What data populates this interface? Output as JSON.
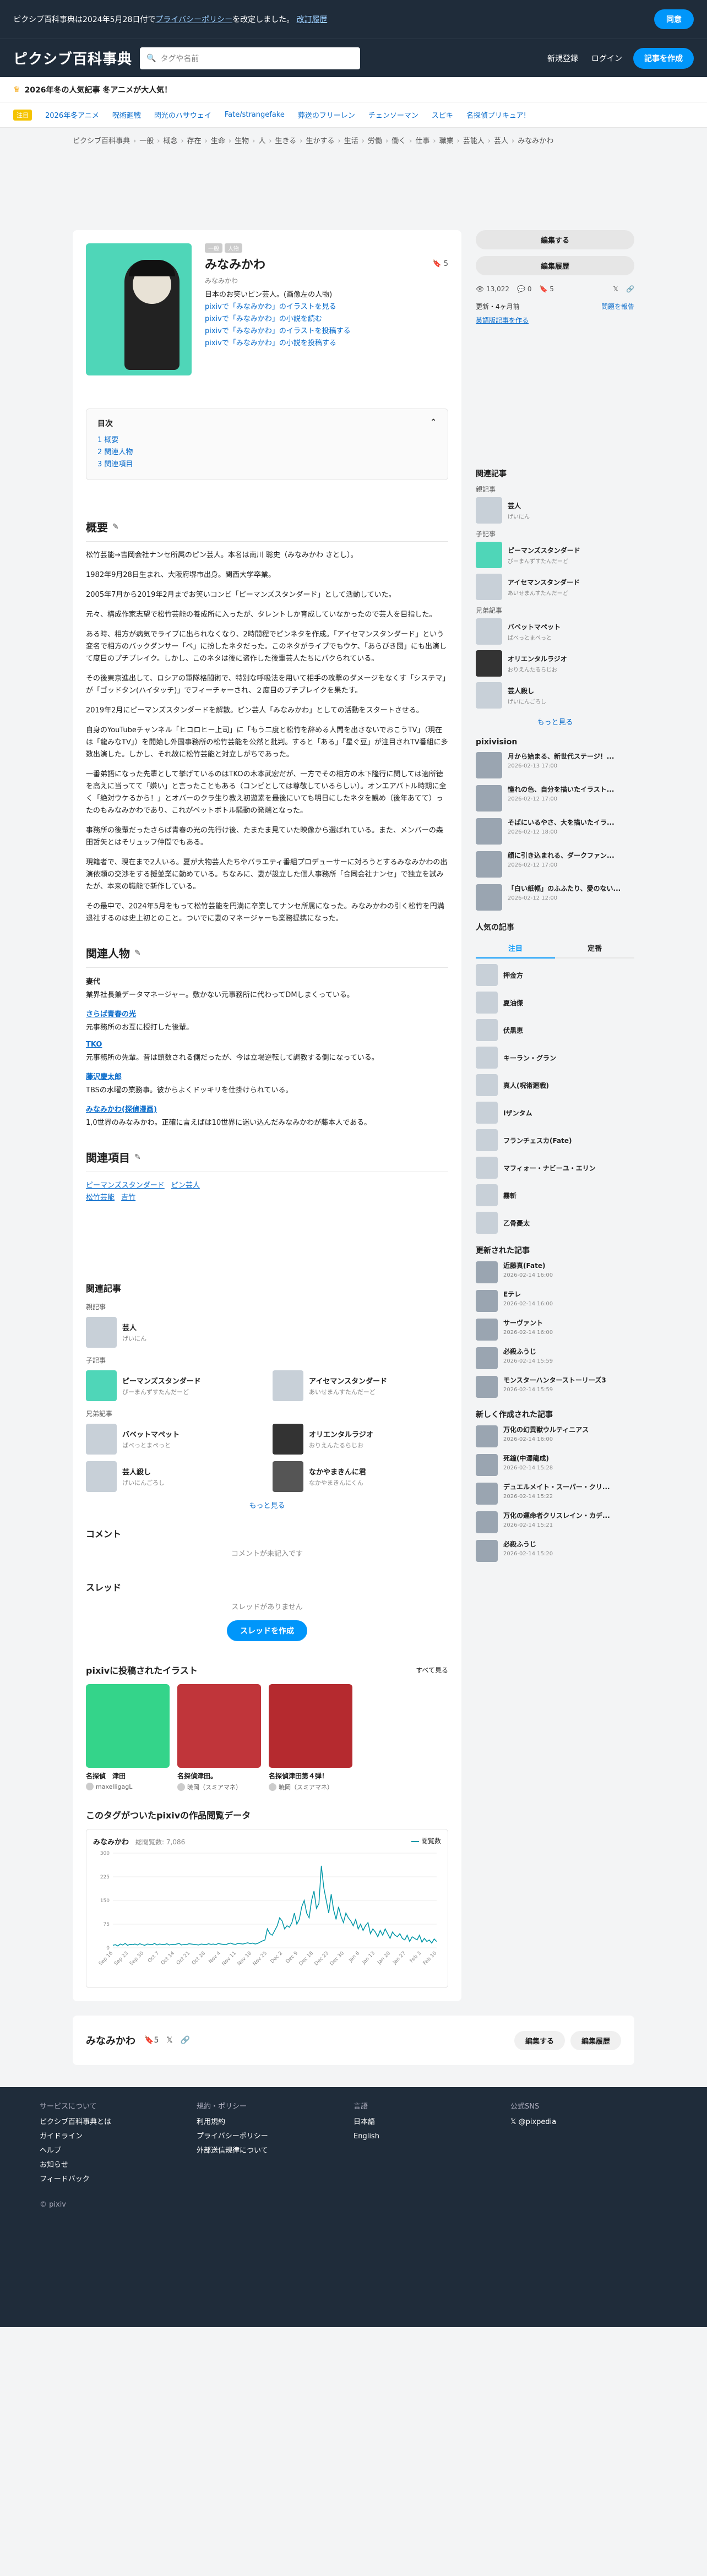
{
  "notice": {
    "prefix": "ピクシブ百科事典は2024年5月28日付で",
    "link": "プライバシーポリシー",
    "suffix": "を改定しました。",
    "link2": "改訂履歴",
    "ok": "同意"
  },
  "header": {
    "logo": "ピクシブ百科事典",
    "search_placeholder": "タグや名前",
    "signup": "新規登録",
    "login": "ログイン",
    "create": "記事を作成"
  },
  "banner": {
    "text": "2026年冬の人気記事 冬アニメが大人気！"
  },
  "tagsbar": {
    "label": "注目",
    "items": [
      "2026年冬アニメ",
      "呪術廻戦",
      "閃光のハサウェイ",
      "Fate/strangefake",
      "葬送のフリーレン",
      "チェンソーマン",
      "スピキ",
      "名探偵プリキュア!"
    ]
  },
  "breadcrumb": [
    "ピクシブ百科事典",
    "一般",
    "概念",
    "存在",
    "生命",
    "生物",
    "人",
    "生きる",
    "生かする",
    "生活",
    "労働",
    "働く",
    "仕事",
    "職業",
    "芸能人",
    "芸人",
    "みなみかわ"
  ],
  "article": {
    "badges": [
      "一般",
      "人物"
    ],
    "title": "みなみかわ",
    "reading": "みなみかわ",
    "bookmark_count": "5",
    "summary": "日本のお笑いピン芸人。(画像左の人物)",
    "pixiv_links": [
      "pixivで「みなみかわ」のイラストを見る",
      "pixivで「みなみかわ」の小説を読む",
      "pixivで「みなみかわ」のイラストを投稿する",
      "pixivで「みなみかわ」の小説を投稿する"
    ]
  },
  "toc": {
    "title": "目次",
    "items": [
      "1 概要",
      "2 関連人物",
      "3 関連項目"
    ]
  },
  "overview": {
    "heading": "概要",
    "paragraphs": [
      "松竹芸能→吉岡会社ナンセ所属のピン芸人。本名は南川 聡史（みなみかわ さとし）。",
      "1982年9月28日生まれ、大阪府堺市出身。関西大学卒業。",
      "2005年7月から2019年2月までお笑いコンビ「ピーマンズスタンダード」として活動していた。",
      "元々、構成作家志望で松竹芸能の養成所に入ったが、タレントしか育成していなかったので芸人を目指した。",
      "ある時、相方が病気でライブに出られなくなり、2時間程でピンネタを作成。「アイセマンスタンダード」という変名で相方のバックダンサー「ペ」に扮したネタだった。このネタがライブでもウケ、「あらびき団」にも出演して度目のプチブレイク。しかし、このネタは後に盗作した後輩芸人たちにパクられている。",
      "その後東京進出して、ロシアの軍隊格闘術で、特別な呼吸法を用いて相手の攻撃のダメージをなくす「システマ」が「ゴッドタン(ハイタッチ)」でフィーチャーされ、２度目のプチブレイクを果たす。",
      "2019年2月にピーマンズスタンダードを解散。ピン芸人「みなみかわ」としての活動をスタートさせる。",
      "自身のYouTubeチャンネル「ヒコロヒー上司」に「もう二度と松竹を辞める人間を出さないでおこうTV」（現在は「龍みなTV」）を開始し外国事務所の松竹芸能を公然と批判。すると「ある」「星ぐ豆」が注目されTV番組に多数出演した。しかし、それ故に松竹芸能と対立しがちであった。",
      "一番弟語になった先輩として挙げているのはTKOの木本武宏だが、一方でその相方の木下隆行に関しては適所徳を高えに当ってて「嫌い」と言ったこともある（コンビとしては尊敬しているらしい）。オンエアバトル時期に全く「絶対ウケるから！」とオバーのクラ生り教え初遊素を最後にいても明日にしたネタを観め（後年あてて）ったのもみなみかわであり、これがペットボトル騒動の発端となった。",
      "事務所の後輩だったさらば青春の光の先行け後、たまたま見ていた映像から選ばれている。また、メンバーの森田哲矢とはそリュッフ仲間でもある。",
      "現籍者で、現在まで2人いる。夏が大物芸人たちやバラエティ番組プロデューサーに対ろうとするみなみかわの出演依頼の交渉をする擬並業に勤めている。ちなみに、妻が設立した個人事務所「合同会社ナンセ」で独立を試みたが、本来の職能で新作している。",
      "その最中で、2024年5月をもって松竹芸能を円満に卒業してナンセ所属になった。みなみかわの引く松竹を円満退社するのは史上初とのこと。ついでに妻のマネージャーも業務提携になった。"
    ]
  },
  "people": {
    "heading": "関連人物",
    "items": [
      {
        "name": "妻代",
        "desc": "業界社長兼データマネージャー。敷かない元事務所に代わってDMしまくっている。",
        "plain": true
      },
      {
        "name": "さらば青春の光",
        "desc": "元事務所のお互に授打した後輩。"
      },
      {
        "name": "TKO",
        "desc": "元事務所の先輩。昔は頭数される側だったが、今は立場逆転して調教する側になっている。"
      },
      {
        "name": "藤沢慶太郎",
        "desc": "TBSの水曜の業務事。彼からよくドッキリを仕掛けられている。"
      },
      {
        "name": "みなみかわ(探偵漫画)",
        "desc": "1,0世界のみなみかわ。正確に言えばは10世界に迷い込んだみなみかわが藤本人である。"
      }
    ]
  },
  "related_items": {
    "heading": "関連項目",
    "links": [
      "ピーマンズスタンダード",
      "ピン芸人",
      "松竹芸能",
      "吉竹"
    ]
  },
  "related_articles": {
    "heading": "関連記事",
    "parent_label": "親記事",
    "parent": [
      {
        "name": "芸人",
        "sub": "げいにん"
      }
    ],
    "child_label": "子記事",
    "children": [
      {
        "name": "ピーマンズスタンダード",
        "sub": "ぴーまんずすたんだーど"
      },
      {
        "name": "アイセマンスタンダード",
        "sub": "あいせまんすたんだーど"
      }
    ],
    "sibling_label": "兄弟記事",
    "siblings": [
      {
        "name": "バベットマペット",
        "sub": "ばべっとまぺっと"
      },
      {
        "name": "オリエンタルラジオ",
        "sub": "おりえんたるらじお"
      },
      {
        "name": "芸人殺し",
        "sub": "げいにんごろし"
      },
      {
        "name": "なかやまきんに君",
        "sub": "なかやまきんにくん"
      }
    ],
    "more": "もっと見る"
  },
  "comments": {
    "heading": "コメント",
    "empty": "コメントが未記入です"
  },
  "threads": {
    "heading": "スレッド",
    "empty": "スレッドがありません",
    "create": "スレッドを作成"
  },
  "illustrations": {
    "heading": "pixivに投稿されたイラスト",
    "see_all": "すべて見る",
    "items": [
      {
        "caption": "名探偵　津田",
        "author": "maxelligagL",
        "color": "#34d48a"
      },
      {
        "caption": "名探偵津田。",
        "author": "暁岡（スミアマネ）",
        "color": "#c0353a"
      },
      {
        "caption": "名探偵津田第４弾！",
        "author": "暁岡（スミアマネ）",
        "color": "#b52a2f"
      }
    ]
  },
  "chart_section": {
    "heading": "このタグがついたpixivの作品閲覧データ",
    "tag": "みなみかわ",
    "total_label": "総閲覧数: 7,086",
    "legend": "閲覧数"
  },
  "chart_data": {
    "type": "line",
    "title": "",
    "xlabel": "",
    "ylabel": "",
    "ylim": [
      0,
      300
    ],
    "yticks": [
      0,
      75,
      150,
      225,
      300
    ],
    "x_labels": [
      "Sep 16",
      "Sep 23",
      "Sep 30",
      "Oct 7",
      "Oct 14",
      "Oct 21",
      "Oct 28",
      "Nov 4",
      "Nov 11",
      "Nov 18",
      "Nov 25",
      "Dec 2",
      "Dec 9",
      "Dec 16",
      "Dec 23",
      "Dec 30",
      "Jan 6",
      "Jan 13",
      "Jan 20",
      "Jan 27",
      "Feb 3",
      "Feb 10"
    ],
    "series": [
      {
        "name": "閲覧数",
        "color": "#0097a7",
        "values": [
          8,
          10,
          6,
          12,
          9,
          14,
          8,
          11,
          10,
          12,
          9,
          13,
          10,
          8,
          12,
          11,
          10,
          14,
          9,
          12,
          11,
          10,
          13,
          9,
          11,
          10,
          12,
          14,
          9,
          11,
          10,
          13,
          12,
          11,
          10,
          9,
          12,
          11,
          10,
          13,
          11,
          12,
          10,
          14,
          12,
          11,
          10,
          13,
          15,
          12,
          11,
          14,
          13,
          12,
          14,
          16,
          13,
          15,
          12,
          14,
          18,
          22,
          25,
          60,
          45,
          40,
          55,
          70,
          95,
          85,
          60,
          70,
          65,
          80,
          110,
          75,
          90,
          130,
          150,
          110,
          95,
          150,
          180,
          125,
          140,
          260,
          190,
          150,
          110,
          170,
          120,
          90,
          130,
          100,
          80,
          110,
          95,
          85,
          70,
          90,
          60,
          75,
          55,
          70,
          80,
          45,
          60,
          50,
          35,
          55,
          40,
          60,
          45,
          30,
          50,
          40,
          35,
          45,
          30,
          25,
          40,
          20,
          35,
          30,
          25,
          40,
          18,
          30,
          20,
          25,
          15,
          28,
          20
        ]
      }
    ]
  },
  "sticky": {
    "name": "みなみかわ",
    "bookmark_count": "5",
    "edit": "編集する",
    "history": "編集履歴"
  },
  "sidebar": {
    "edit": "編集する",
    "history": "編集履歴",
    "views": "13,022",
    "comments": "0",
    "bookmarks": "5",
    "updated": "更新・4ヶ月前",
    "report": "問題を報告",
    "notify": "英語版記事を作る",
    "related_heading": "関連記事",
    "parent_label": "親記事",
    "parent": [
      {
        "name": "芸人",
        "sub": "げいにん"
      }
    ],
    "child_label": "子記事",
    "children": [
      {
        "name": "ピーマンズスタンダード",
        "sub": "ぴーまんずすたんだーど"
      },
      {
        "name": "アイセマンスタンダード",
        "sub": "あいせまんすたんだーど"
      }
    ],
    "sibling_label": "兄弟記事",
    "siblings": [
      {
        "name": "バベットマペット",
        "sub": "ばべっとまぺっと"
      },
      {
        "name": "オリエンタルラジオ",
        "sub": "おりえんたるらじお"
      },
      {
        "name": "芸人殺し",
        "sub": "げいにんごろし"
      }
    ],
    "more": "もっと見る",
    "pixivision_heading": "pixivision",
    "pixivision": [
      {
        "title": "月から始まる、新世代ステージ！...",
        "date": "2026-02-13 17:00"
      },
      {
        "title": "憧れの色、自分を描いたイラスト...",
        "date": "2026-02-12 17:00"
      },
      {
        "title": "そばにいるやさ、大を描いたイラ...",
        "date": "2026-02-12 18:00"
      },
      {
        "title": "顔に引き込まれる、ダークファン...",
        "date": "2026-02-12 17:00"
      },
      {
        "title": "「白い紙幅」のふふたり、愛のない...",
        "date": "2026-02-12 12:00"
      }
    ],
    "popular_heading": "人気の記事",
    "popular_tabs": [
      "注目",
      "定番"
    ],
    "popular": [
      "押金方",
      "夏油傑",
      "伏黒恵",
      "キーラン・グラン",
      "真人(呪術廻戦)",
      "Iザンタム",
      "フランチェスカ(Fate)",
      "マフィォー・ナビーユ・エリン",
      "霧斬",
      "乙骨憂太"
    ],
    "updated_heading": "更新された記事",
    "updated_items": [
      {
        "title": "近藤真(Fate)",
        "date": "2026-02-14 16:00"
      },
      {
        "title": "Eテレ",
        "date": "2026-02-14 16:00"
      },
      {
        "title": "サーヴァント",
        "date": "2026-02-14 16:00"
      },
      {
        "title": "必殺ふうじ",
        "date": "2026-02-14 15:59"
      },
      {
        "title": "モンスターハンターストーリーズ3",
        "date": "2026-02-14 15:59"
      }
    ],
    "new_heading": "新しく作成された記事",
    "new_items": [
      {
        "title": "万化の幻異獣ウルティニアス",
        "date": "2026-02-14 16:00"
      },
      {
        "title": "死鐘(中澤龍成)",
        "date": "2026-02-14 15:28"
      },
      {
        "title": "デュエルメイト・スーパー・クリ...",
        "date": "2026-02-14 15:22"
      },
      {
        "title": "万化の運命者クリスレイン・カデ...",
        "date": "2026-02-14 15:21"
      },
      {
        "title": "必殺ふうじ",
        "date": "2026-02-14 15:20"
      }
    ]
  },
  "footer": {
    "col1_title": "サービスについて",
    "col1": [
      "ピクシブ百科事典とは",
      "ガイドライン",
      "ヘルプ",
      "お知らせ",
      "フィードバック"
    ],
    "col2_title": "規約・ポリシー",
    "col2": [
      "利用規約",
      "プライバシーポリシー",
      "外部送信規律について"
    ],
    "col3_title": "言語",
    "col3": [
      "日本語",
      "English"
    ],
    "col4_title": "公式SNS",
    "col4": [
      "@pixpedia"
    ],
    "copy": "© pixiv"
  }
}
